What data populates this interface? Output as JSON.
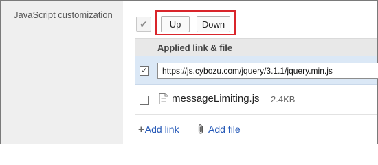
{
  "field": {
    "label": "JavaScript customization"
  },
  "toolbar": {
    "select_all_glyph": "✔",
    "up_label": "Up",
    "down_label": "Down",
    "highlight_color": "#d9252b"
  },
  "table": {
    "column_header": "Applied link & file",
    "rows": [
      {
        "checked": true,
        "check_glyph": "✓",
        "type": "link",
        "value": "https://js.cybozu.com/jquery/3.1.1/jquery.min.js"
      },
      {
        "checked": false,
        "check_glyph": "",
        "type": "file",
        "icon": "file-icon",
        "name": "messageLimiting.js",
        "size": "2.4KB"
      }
    ]
  },
  "actions": {
    "add_link_icon": "+",
    "add_link_label": "Add link",
    "add_file_icon": "paperclip-icon",
    "add_file_label": "Add file"
  },
  "colors": {
    "selected_row_bg": "#dbe8f6",
    "header_bg": "#e8e8e8",
    "label_col_bg": "#efefef",
    "link_color": "#2458b7"
  }
}
